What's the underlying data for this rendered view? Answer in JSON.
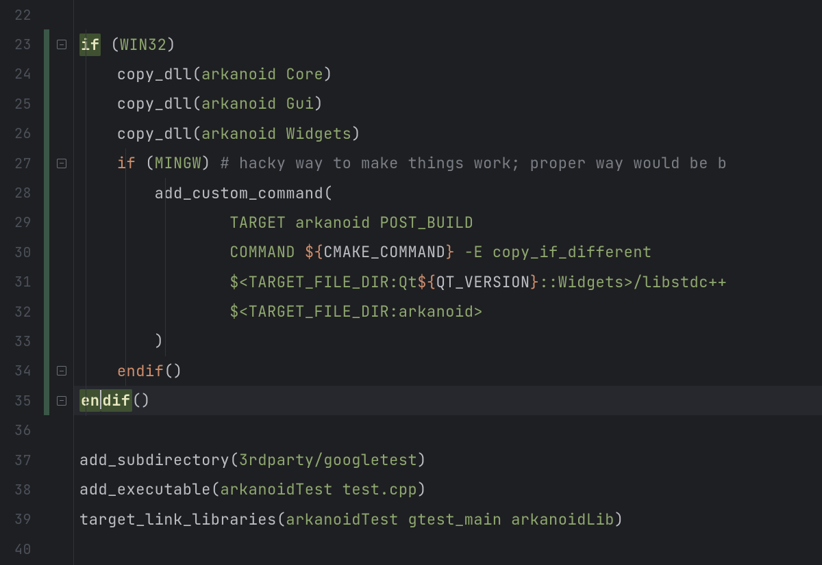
{
  "editor": {
    "first_line_number": 22,
    "current_line": 35,
    "lines": [
      {
        "num": 22,
        "html": "",
        "changed": false,
        "fold": null
      },
      {
        "num": 23,
        "html": "<span class='hl-kw'>if</span><span class='tok-def'> (</span><span class='tok-ident'>WIN32</span><span class='tok-def'>)</span>",
        "changed": true,
        "fold": "open",
        "indent": 0
      },
      {
        "num": 24,
        "html": "<span class='tok-def'>    copy_dll(</span><span class='tok-ident'>arkanoid</span><span class='tok-def'> </span><span class='tok-ident'>Core</span><span class='tok-def'>)</span>",
        "changed": true,
        "fold": null
      },
      {
        "num": 25,
        "html": "<span class='tok-def'>    copy_dll(</span><span class='tok-ident'>arkanoid</span><span class='tok-def'> </span><span class='tok-ident'>Gui</span><span class='tok-def'>)</span>",
        "changed": true,
        "fold": null
      },
      {
        "num": 26,
        "html": "<span class='tok-def'>    copy_dll(</span><span class='tok-ident'>arkanoid</span><span class='tok-def'> </span><span class='tok-ident'>Widgets</span><span class='tok-def'>)</span>",
        "changed": true,
        "fold": null
      },
      {
        "num": 27,
        "html": "<span class='tok-def'>    </span><span class='tok-key'>if</span><span class='tok-def'> (</span><span class='tok-ident'>MINGW</span><span class='tok-def'>) </span><span class='tok-comment'># hacky way to make things work; proper way would be b</span>",
        "changed": true,
        "fold": "open",
        "indent": 1
      },
      {
        "num": 28,
        "html": "<span class='tok-def'>        add_custom_command(</span>",
        "changed": true,
        "fold": null
      },
      {
        "num": 29,
        "html": "<span class='tok-def'>                </span><span class='tok-ident'>TARGET</span><span class='tok-def'> </span><span class='tok-ident'>arkanoid</span><span class='tok-def'> </span><span class='tok-ident'>POST_BUILD</span>",
        "changed": true,
        "fold": null
      },
      {
        "num": 30,
        "html": "<span class='tok-def'>                </span><span class='tok-ident'>COMMAND</span><span class='tok-def'> </span><span class='tok-var-brace'>${</span><span class='tok-varname'>CMAKE_COMMAND</span><span class='tok-var-brace'>}</span><span class='tok-def'> </span><span class='tok-ident'>-E</span><span class='tok-def'> </span><span class='tok-ident'>copy_if_different</span>",
        "changed": true,
        "fold": null
      },
      {
        "num": 31,
        "html": "<span class='tok-def'>                </span><span class='tok-ident'>$&lt;TARGET_FILE_DIR:Qt</span><span class='tok-var-brace'>${</span><span class='tok-varname'>QT_VERSION</span><span class='tok-var-brace'>}</span><span class='tok-ident'>::Widgets&gt;/libstdc++</span>",
        "changed": true,
        "fold": null
      },
      {
        "num": 32,
        "html": "<span class='tok-def'>                </span><span class='tok-ident'>$&lt;TARGET_FILE_DIR:arkanoid&gt;</span>",
        "changed": true,
        "fold": null
      },
      {
        "num": 33,
        "html": "<span class='tok-def'>        )</span>",
        "changed": true,
        "fold": null
      },
      {
        "num": 34,
        "html": "<span class='tok-def'>    </span><span class='tok-key'>endif</span><span class='tok-def'>()</span>",
        "changed": true,
        "fold": "close",
        "indent": 1
      },
      {
        "num": 35,
        "html": "<span class='hl-kw'>en</span><span class='caret'></span><span class='hl-kw'>dif</span><span class='tok-def'>()</span>",
        "changed": true,
        "fold": "close",
        "indent": 0
      },
      {
        "num": 36,
        "html": "",
        "changed": false,
        "fold": null
      },
      {
        "num": 37,
        "html": "<span class='tok-def'>add_subdirectory(</span><span class='tok-ident'>3rdparty/googletest</span><span class='tok-def'>)</span>",
        "changed": false,
        "fold": null
      },
      {
        "num": 38,
        "html": "<span class='tok-def'>add_executable(</span><span class='tok-ident'>arkanoidTest</span><span class='tok-def'> </span><span class='tok-ident'>test.cpp</span><span class='tok-def'>)</span>",
        "changed": false,
        "fold": null
      },
      {
        "num": 39,
        "html": "<span class='tok-def'>target_link_libraries(</span><span class='tok-ident'>arkanoidTest</span><span class='tok-def'> </span><span class='tok-ident'>gtest_main</span><span class='tok-def'> </span><span class='tok-ident'>arkanoidLib</span><span class='tok-def'>)</span>",
        "changed": false,
        "fold": null
      },
      {
        "num": 40,
        "html": "",
        "changed": false,
        "fold": null
      }
    ]
  },
  "colors": {
    "bg": "#1e1f22",
    "gutter_fg": "#4b5059",
    "keyword": "#cf8e6d",
    "identifier": "#8fa86f",
    "default": "#bcbec4",
    "comment": "#7a7e85",
    "highlight_bg": "#3f5131",
    "change_marker": "#3a5748",
    "current_line": "#26282e"
  }
}
